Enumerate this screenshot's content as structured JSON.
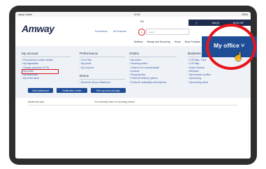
{
  "status": {
    "left": "●●●● Carrier",
    "center": "12:15",
    "right": "100%"
  },
  "header": {
    "logo": "Amway",
    "links": [
      "Promotions",
      "All Products"
    ],
    "search_placeholder": "search",
    "lang": [
      "EN"
    ],
    "cart": [
      "Cart (0)",
      "00.00 CHF"
    ]
  },
  "nav": [
    "Nutrition",
    "Beauty and Grooming",
    "Home",
    "More Products"
  ],
  "columns": [
    {
      "title": "My account",
      "items": [
        "Personal and contact details",
        "My registration",
        "Change password & PIN",
        "My profile",
        "My addresses",
        "My credit cards"
      ]
    },
    {
      "title": "Performance",
      "items": [
        "Core Plan",
        "My points",
        "My coupons"
      ]
    },
    {
      "title": "Orders",
      "items": [
        "My orders",
        "Incoming orders",
        "Orders to be accepted/paid",
        "Invoices",
        "Shopping lists",
        "Preferred delivery options",
        "Products' availability subscriptions"
      ]
    },
    {
      "title": "Business manager",
      "items": [
        "LOS Map - New",
        "LOS Map",
        "Action Reports",
        "Websites",
        "My business profiles",
        "Sponsoring",
        "Sponsoring status"
      ]
    }
  ],
  "bonus": {
    "title": "Bonus",
    "items": [
      "Electronic Bonus Statement"
    ]
  },
  "buttons": [
    "View dashboard",
    "Notification centre",
    "Edit my personal page"
  ],
  "lower": {
    "left": "Month and year",
    "right": "You currently have no incoming orders."
  },
  "myoffice": {
    "label": "My office ˅"
  }
}
